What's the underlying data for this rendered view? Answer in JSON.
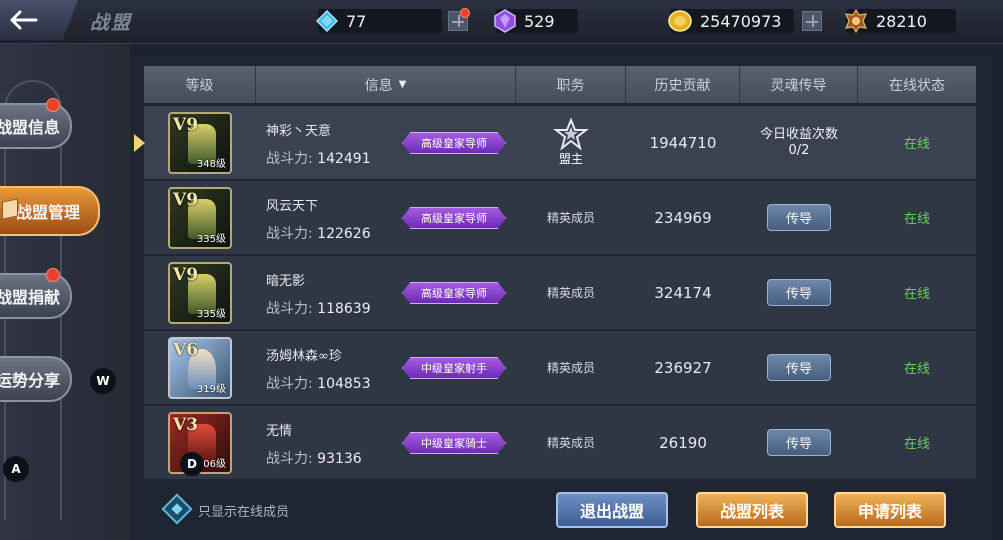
{
  "topbar": {
    "title": "战盟",
    "resources": [
      {
        "icon": "diamond-icon",
        "value": "77"
      },
      {
        "icon": "crystal-icon",
        "value": "529"
      },
      {
        "icon": "gold-coin-icon",
        "value": "25470973"
      },
      {
        "icon": "rank-emblem-icon",
        "value": "28210"
      }
    ]
  },
  "sidebar": {
    "items": [
      {
        "label": "战盟信息",
        "active": false,
        "has_notification": true
      },
      {
        "label": "战盟管理",
        "active": true,
        "has_notification": false
      },
      {
        "label": "战盟捐献",
        "active": false,
        "has_notification": true
      },
      {
        "label": "运势分享",
        "active": false,
        "has_notification": false
      }
    ],
    "tags": [
      "W",
      "A"
    ]
  },
  "table": {
    "headers": {
      "level": "等级",
      "info": "信息",
      "role": "职务",
      "contribution": "历史贡献",
      "soul": "灵魂传导",
      "status": "在线状态"
    },
    "rows": [
      {
        "vip": "V9",
        "level": "348级",
        "name": "神彩丶天意",
        "power_label": "战斗力:",
        "power": "142491",
        "title": "高级皇家导师",
        "role": "盟主",
        "contribution": "1944710",
        "soul_line1": "今日收益次数",
        "soul_line2": "0/2",
        "status": "在线"
      },
      {
        "vip": "V9",
        "level": "335级",
        "name": "风云天下",
        "power_label": "战斗力:",
        "power": "122626",
        "title": "高级皇家导师",
        "role": "精英成员",
        "contribution": "234969",
        "soul_button": "传导",
        "status": "在线"
      },
      {
        "vip": "V9",
        "level": "335级",
        "name": "暗无影",
        "power_label": "战斗力:",
        "power": "118639",
        "title": "高级皇家导师",
        "role": "精英成员",
        "contribution": "324174",
        "soul_button": "传导",
        "status": "在线"
      },
      {
        "vip": "V6",
        "level": "319级",
        "name": "汤姆林森∞珍",
        "power_label": "战斗力:",
        "power": "104853",
        "title": "中级皇家射手",
        "role": "精英成员",
        "contribution": "236927",
        "soul_button": "传导",
        "status": "在线"
      },
      {
        "vip": "V3",
        "level": "306级",
        "name": "无情",
        "power_label": "战斗力:",
        "power": "93136",
        "title": "中级皇家骑士",
        "role": "精英成员",
        "contribution": "26190",
        "soul_button": "传导",
        "status": "在线",
        "tag": "D"
      }
    ]
  },
  "footer": {
    "checkbox_label": "只显示在线成员",
    "buttons": {
      "leave": "退出战盟",
      "list": "战盟列表",
      "apply": "申请列表"
    }
  },
  "colors": {
    "online": "#69d15a",
    "title_badge": "#8b43cf",
    "active_tab": "#d07a2c"
  }
}
